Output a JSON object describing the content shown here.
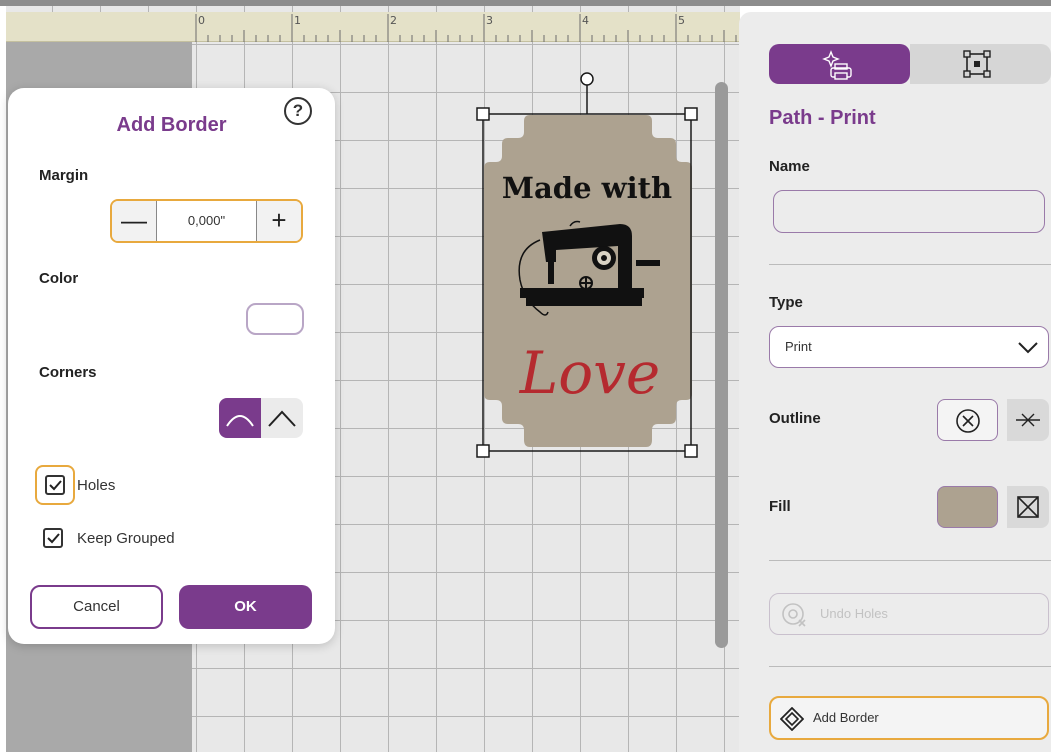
{
  "ruler": {
    "labels": [
      "0",
      "1",
      "2",
      "3",
      "4",
      "5"
    ]
  },
  "artwork": {
    "line1": "Made with",
    "line2": "Love",
    "fill_color": "#ada290",
    "text_color": "#111111",
    "script_color": "#b52a2f"
  },
  "dialog": {
    "title": "Add Border",
    "help_glyph": "?",
    "margin_label": "Margin",
    "margin_value": "0,000\"",
    "minus_glyph": "—",
    "plus_glyph": "+",
    "color_label": "Color",
    "corners_label": "Corners",
    "holes_label": "Holes",
    "holes_checked": true,
    "keep_grouped_label": "Keep Grouped",
    "keep_grouped_checked": true,
    "cancel_label": "Cancel",
    "ok_label": "OK"
  },
  "panel": {
    "title": "Path - Print",
    "name_label": "Name",
    "name_value": "",
    "type_label": "Type",
    "type_value": "Print",
    "outline_label": "Outline",
    "fill_label": "Fill",
    "fill_color": "#ada290",
    "undo_holes_label": "Undo Holes",
    "add_border_label": "Add Border"
  },
  "colors": {
    "accent": "#7a3b8c",
    "focus": "#e8a93e",
    "canvas": "#e8e8e8",
    "ruler": "#e4e1c8"
  }
}
